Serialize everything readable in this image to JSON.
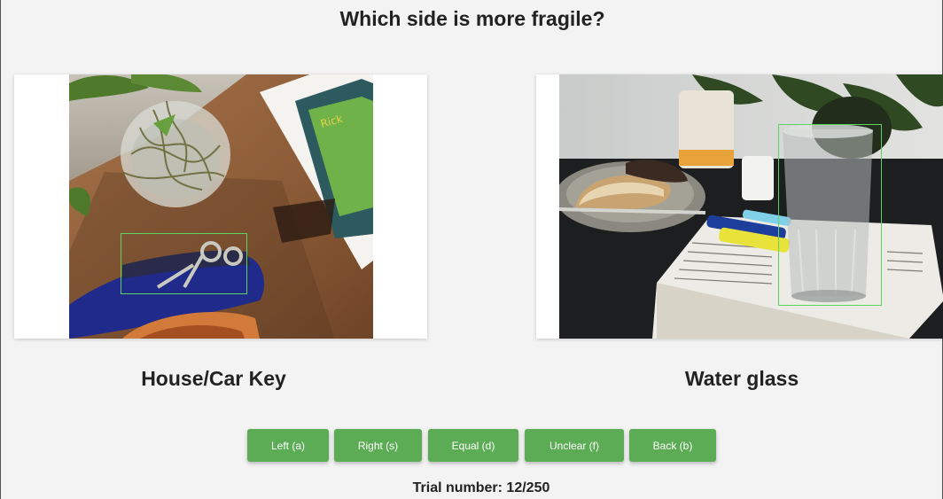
{
  "question": "Which side is more fragile?",
  "left": {
    "image_alt": "Keys on a blue keychain on a wooden table",
    "object_label": "House/Car Key"
  },
  "right": {
    "image_alt": "Water glass on a book on a dark table",
    "object_label": "Water glass"
  },
  "buttons": {
    "left": "Left (a)",
    "right": "Right (s)",
    "equal": "Equal (d)",
    "unclear": "Unclear (f)",
    "back": "Back (b)"
  },
  "trial_text": "Trial number: 12/250",
  "colors": {
    "button": "#5cac55",
    "bbox": "#5fd35f",
    "background": "#f3f3f3"
  }
}
